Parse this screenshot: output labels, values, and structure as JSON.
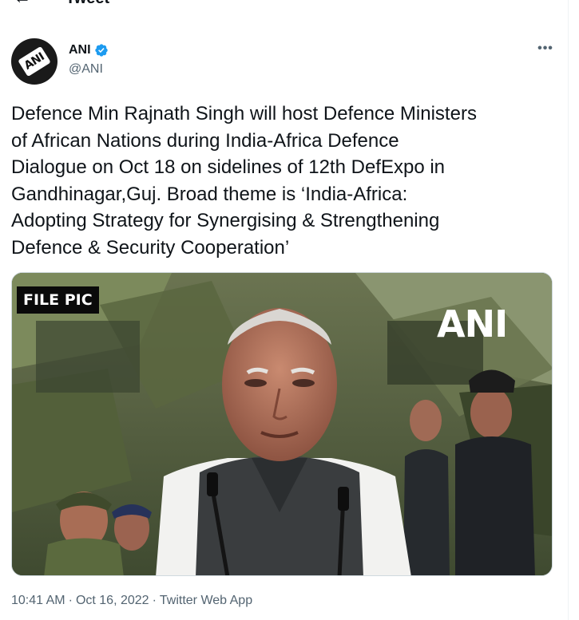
{
  "topbar": {
    "back_icon": "arrow-left-icon",
    "title": "Tweet"
  },
  "author": {
    "display_name": "ANI",
    "handle": "@ANI",
    "avatar_text": "ANI",
    "verified_color": "#1d9bf0"
  },
  "tweet": {
    "text": "Defence Min Rajnath Singh will host Defence Ministers\nof African Nations during India-Africa Defence\nDialogue on Oct 18 on sidelines of 12th DefExpo in\nGandhinagar,Guj. Broad theme is ‘India-Africa:\nAdopting Strategy for Synergising & Strengthening\nDefence & Security Cooperation’",
    "media": {
      "overlay_label": "FILE PIC",
      "watermark": "ANI"
    }
  },
  "meta": {
    "time": "10:41 AM",
    "date": "Oct 16, 2022",
    "source": "Twitter Web App",
    "separator": "·"
  },
  "more_icon": "more-horizontal-icon"
}
